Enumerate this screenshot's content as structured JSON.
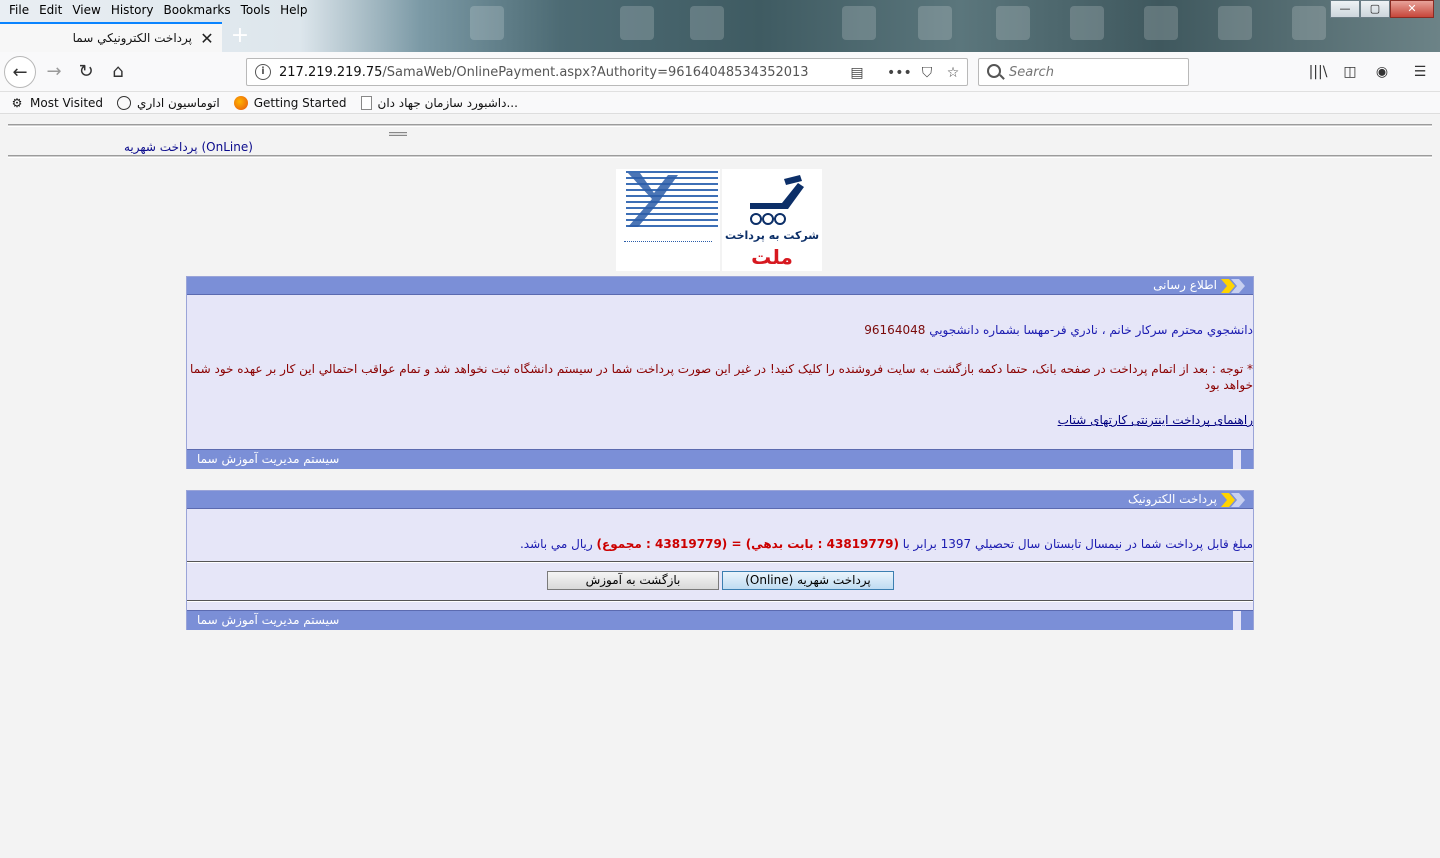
{
  "menu": [
    "File",
    "Edit",
    "View",
    "History",
    "Bookmarks",
    "Tools",
    "Help"
  ],
  "window": {
    "minimize": "—",
    "maximize": "▢",
    "close": "✕"
  },
  "tab": {
    "title": "پرداخت الکترونيکي سما",
    "close": "✕",
    "new_tab": "+"
  },
  "nav": {
    "back": "←",
    "forward": "→",
    "reload": "↻",
    "home": "⌂",
    "url_host": "217.219.219.75",
    "url_path": "/SamaWeb/OnlinePayment.aspx?Authority=96164048534352013",
    "search_placeholder": "Search",
    "reader": "▤",
    "more": "•••",
    "pocket": "⛉",
    "star": "☆",
    "library": "|||\\",
    "sidebar": "◫",
    "account": "◉",
    "menu": "☰"
  },
  "bookmarks": [
    {
      "label": "Most Visited",
      "icon": "gear-icon"
    },
    {
      "label": "اتوماسيون اداري",
      "icon": "globe-icon"
    },
    {
      "label": "Getting Started",
      "icon": "firefox-icon"
    },
    {
      "label": "داشبورد سازمان جهاد دان...",
      "icon": "page-icon"
    }
  ],
  "page": {
    "title": "پرداخت شهريه (OnLine)",
    "logos": {
      "mellat_name": "شرکت به پرداخت",
      "mellat_word": "ملت"
    },
    "info_panel": {
      "header": "اطلاع رسانى",
      "student_prefix": "دانشجوي محترم سرکار خانم ، نادري فر-مهسا بشماره دانشجويي",
      "student_number": "96164048",
      "notice": "* توجه : بعد از اتمام پرداخت در صفحه بانک، حتما دکمه بازگشت به سايت فروشنده را کليک کنيد! در غير اين صورت پرداخت شما در سيستم دانشگاه ثبت نخواهد شد و تمام عواقب احتمالي اين کار بر عهده خود شما خواهد بود",
      "help_link": "راهنماى پرداخت اينترنتى کارتهاى شتاب",
      "footer": "سيستم مديريت آموزش سما"
    },
    "payment_panel": {
      "header": "پرداخت الكترونيک",
      "amount_prefix": "مبلغ قابل پرداخت شما در نيمسال تابستان سال تحصيلي 1397 برابر با",
      "amount_expr": "(43819779 : بابت بدهي) = (43819779 : مجموع)",
      "amount_suffix": "ريال مي باشد.",
      "pay_button": "پرداخت شهريه (Online)",
      "back_button": "بازگشت به آموزش",
      "footer": "سيستم مديريت آموزش سما"
    }
  }
}
